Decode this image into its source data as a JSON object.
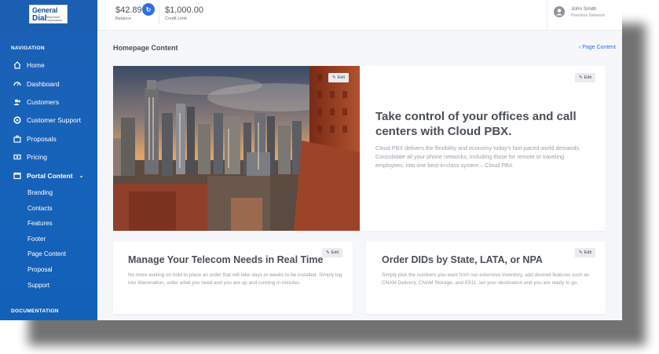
{
  "header": {
    "balance_value": "$42.89",
    "balance_label": "Balance",
    "credit_value": "$1,000.00",
    "credit_label": "Credit Limit",
    "user_name": "John Smith",
    "user_company": "Peerless Network"
  },
  "logo": {
    "line1": "General",
    "line2": "Dial",
    "tagline": "Telephone Corporation"
  },
  "sidebar": {
    "nav_heading": "NAVIGATION",
    "items": [
      {
        "label": "Home",
        "icon": "home-icon"
      },
      {
        "label": "Dashboard",
        "icon": "gauge-icon"
      },
      {
        "label": "Customers",
        "icon": "users-icon"
      },
      {
        "label": "Customer Support",
        "icon": "lifebuoy-icon"
      },
      {
        "label": "Proposals",
        "icon": "briefcase-icon"
      },
      {
        "label": "Pricing",
        "icon": "money-icon"
      },
      {
        "label": "Portal Content",
        "icon": "window-icon"
      }
    ],
    "portal_sub": [
      "Branding",
      "Contacts",
      "Features",
      "Footer",
      "Page Content",
      "Proposal",
      "Support"
    ],
    "doc_heading": "DOCUMENTATION"
  },
  "page": {
    "title": "Homepage Content",
    "breadcrumb": "Page Content",
    "edit_label": "Edit"
  },
  "hero": {
    "heading": "Take control of your offices and call centers with Cloud PBX.",
    "body": "Cloud PBX delivers the flexibility and economy today's fast-paced world demands. Consolidate all your phone networks, including those for remote or traveling employees, into one best-in-class system – Cloud PBX."
  },
  "cards": [
    {
      "heading": "Manage Your Telecom Needs in Real Time",
      "body": "No more waiting on hold to place an order that will take days or weeks to be installed. Simply log into Wavenation, order what you need and you are up and running in minutes."
    },
    {
      "heading": "Order DIDs by State, LATA, or NPA",
      "body": "Simply pick the numbers you want from our extensive inventory, add desired features such as CNAM Delivery, CNAM Storage, and E911, set your destination and you are ready to go."
    }
  ],
  "colors": {
    "sidebar": "#1763ba",
    "accent": "#2f6fe0",
    "background": "#f6f7fa"
  }
}
